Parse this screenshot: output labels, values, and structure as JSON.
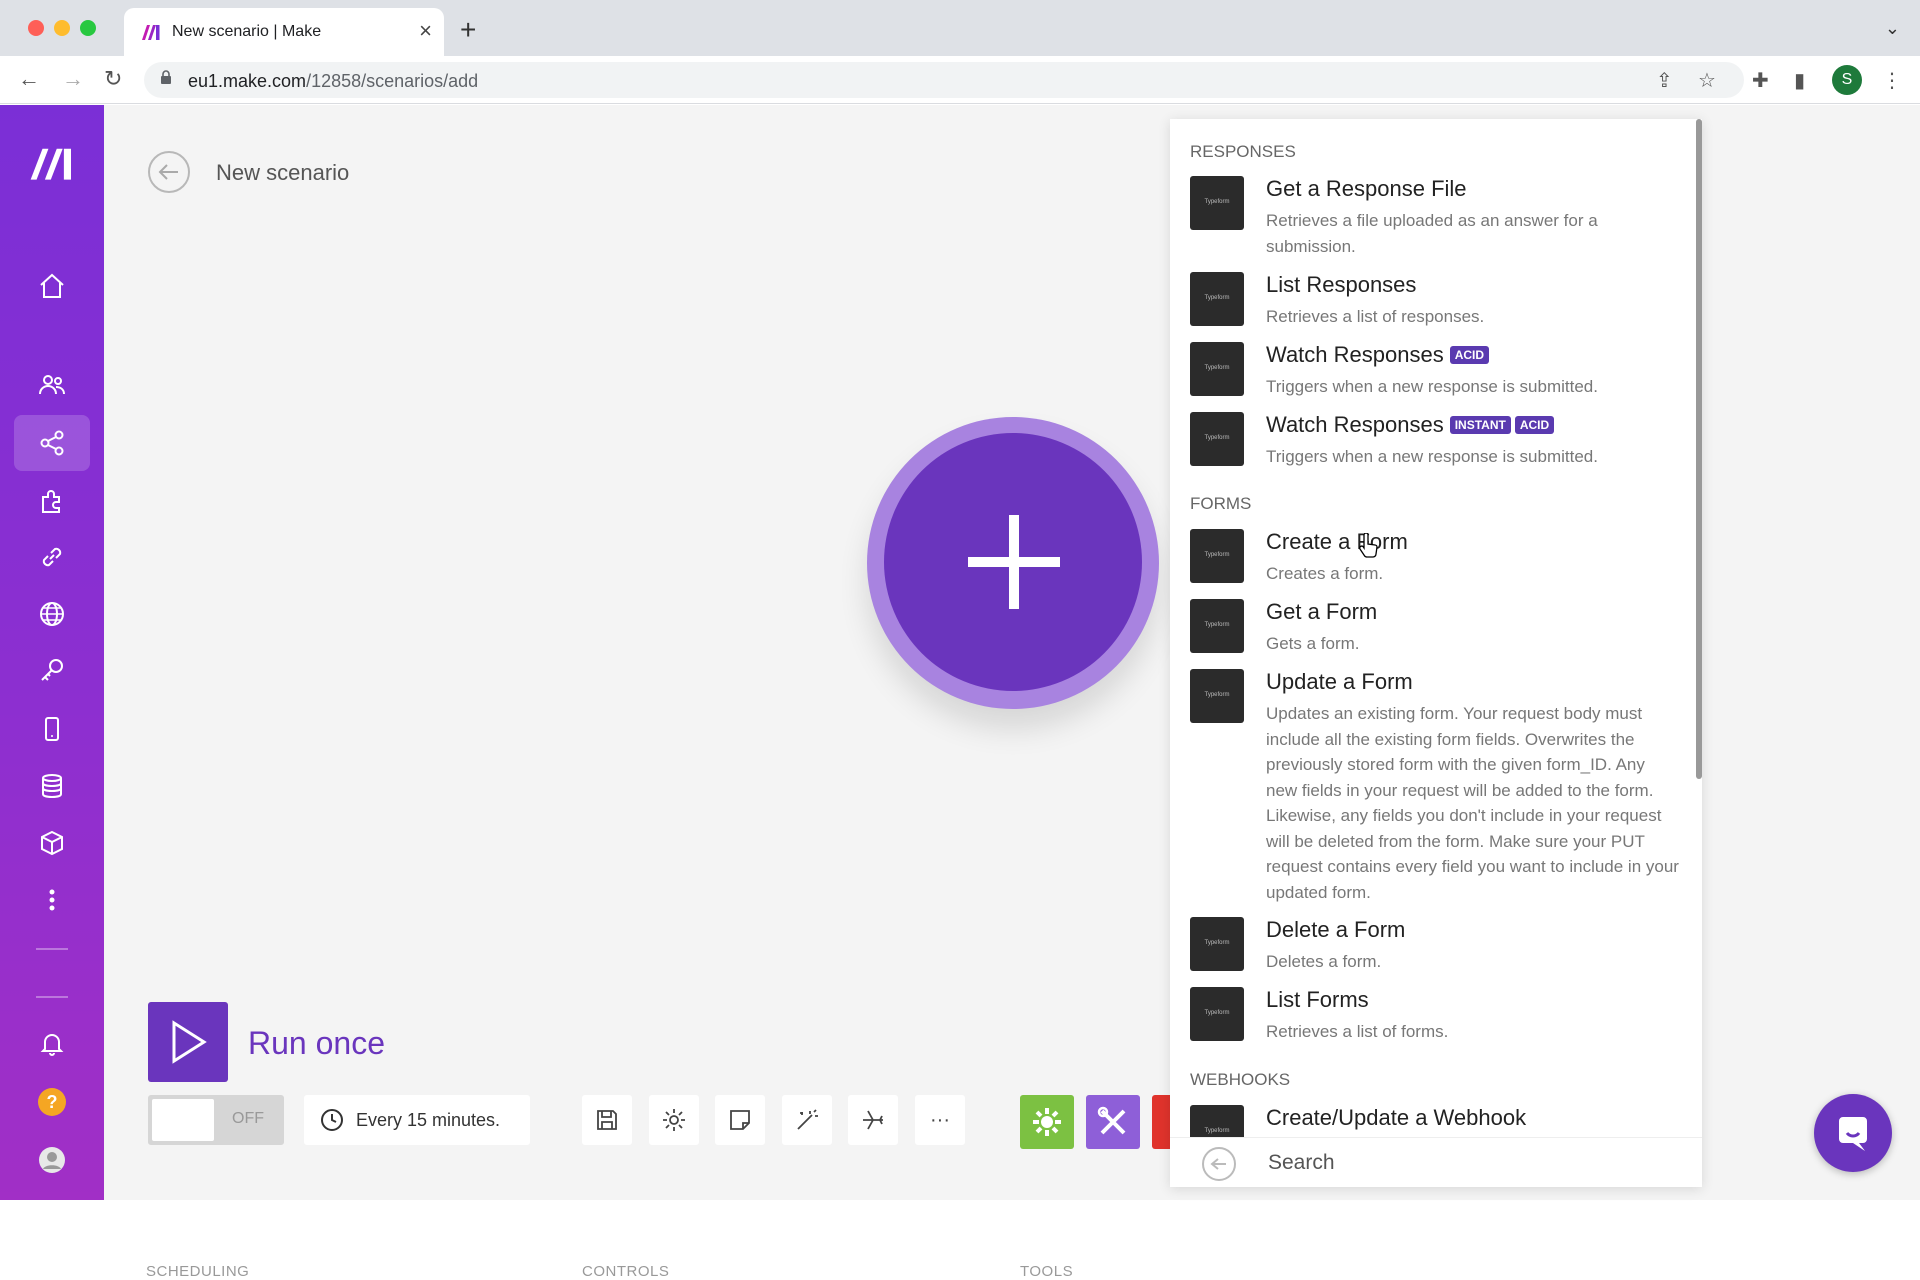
{
  "browser": {
    "tab_title": "New scenario | Make",
    "url_host": "eu1.make.com",
    "url_path": "/12858/scenarios/add",
    "profile_initial": "S"
  },
  "sidebar": {
    "items": [
      "home-icon",
      "team-icon",
      "scenarios-icon",
      "templates-icon",
      "connections-icon",
      "webhooks-icon",
      "keys-icon",
      "devices-icon",
      "datastores-icon",
      "datastructures-icon",
      "more-icon"
    ],
    "active": "scenarios-icon",
    "bottom": [
      "notifications-icon",
      "help-icon",
      "profile-icon"
    ],
    "help_glyph": "?"
  },
  "header": {
    "title": "New scenario"
  },
  "run": {
    "label": "Run once"
  },
  "scheduling": {
    "toggle_state": "OFF",
    "interval": "Every 15 minutes.",
    "section_label": "SCHEDULING"
  },
  "controls": {
    "section_label": "CONTROLS",
    "more_glyph": "···"
  },
  "tools": {
    "section_label": "TOOLS"
  },
  "panel": {
    "logo_text": "Typeform",
    "groups": [
      {
        "heading": "RESPONSES",
        "items": [
          {
            "title": "Get a Response File",
            "desc": "Retrieves a file uploaded as an answer for a submission."
          },
          {
            "title": "List Responses",
            "desc": "Retrieves a list of responses."
          },
          {
            "title": "Watch Responses",
            "badges": [
              "ACID"
            ],
            "desc": "Triggers when a new response is submitted."
          },
          {
            "title": "Watch Responses",
            "badges": [
              "INSTANT",
              "ACID"
            ],
            "desc": "Triggers when a new response is submitted."
          }
        ]
      },
      {
        "heading": "FORMS",
        "items": [
          {
            "title": "Create a Form",
            "desc": "Creates a form."
          },
          {
            "title": "Get a Form",
            "desc": "Gets a form."
          },
          {
            "title": "Update a Form",
            "desc": "Updates an existing form. Your request body must include all the existing form fields. Overwrites the previously stored form with the given form_ID. Any new fields in your request will be added to the form. Likewise, any fields you don't include in your request will be deleted from the form. Make sure your PUT request contains every field you want to include in your updated form."
          },
          {
            "title": "Delete a Form",
            "desc": "Deletes a form."
          },
          {
            "title": "List Forms",
            "desc": "Retrieves a list of forms."
          }
        ]
      },
      {
        "heading": "WEBHOOKS",
        "items": [
          {
            "title": "Create/Update a Webhook",
            "desc": ""
          }
        ]
      }
    ],
    "search_placeholder": "Search"
  },
  "colors": {
    "brand_purple": "#6a35bd",
    "tools_green": "#7cc142",
    "tools_purple": "#8e5fd8",
    "tools_red": "#e0332c"
  }
}
